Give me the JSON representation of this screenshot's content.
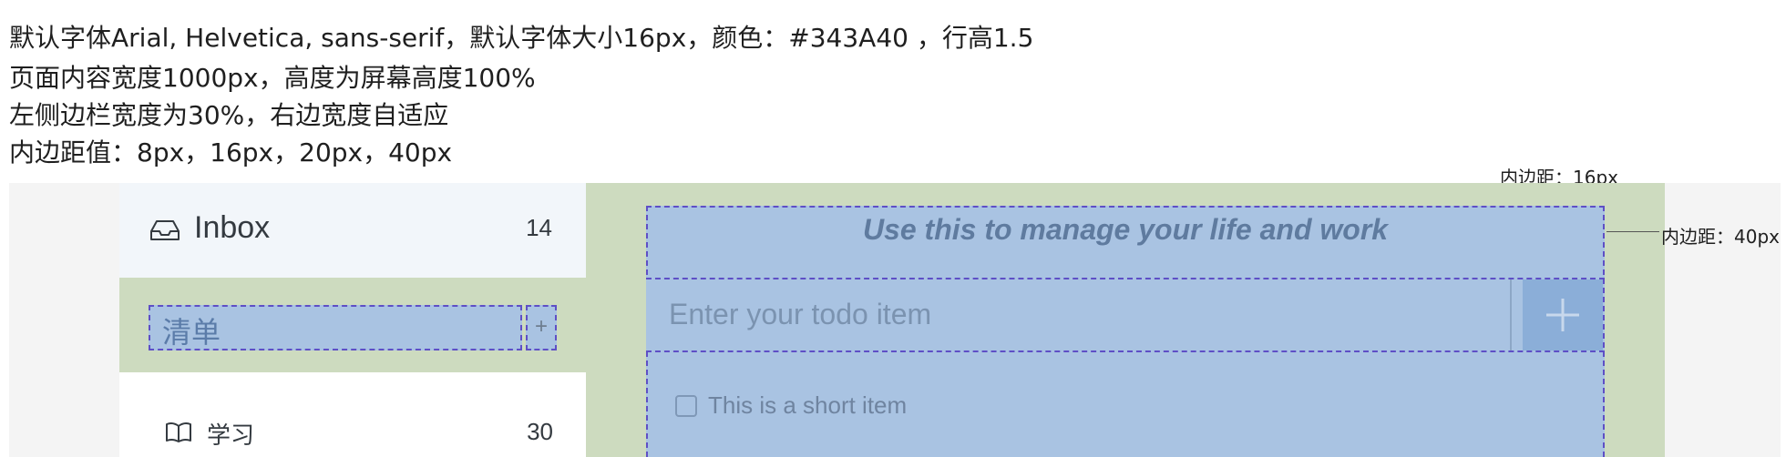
{
  "notes": {
    "line1": "默认字体Arial, Helvetica, sans-serif，默认字体大小16px，颜色：#343A40 ，行高1.5",
    "line2": "页面内容宽度1000px，高度为屏幕高度100%",
    "line3": "左侧边栏宽度为30%，右边宽度自适应",
    "line4": "内边距值：8px，16px，20px，40px"
  },
  "annotations": {
    "top_padding": "内边距：16px",
    "right_padding": "内边距：40px"
  },
  "sidebar": {
    "inbox": {
      "label": "Inbox",
      "count": "14",
      "icon": "inbox-icon"
    },
    "list_input": {
      "placeholder": "清单",
      "add_label": "+"
    },
    "items": [
      {
        "label": "学习",
        "count": "30",
        "icon": "book-icon"
      }
    ]
  },
  "main": {
    "tagline": "Use this to manage your life and work",
    "todo_placeholder": "Enter your todo item",
    "add_icon": "plus-icon",
    "items": [
      {
        "label": "This is a short item",
        "checked": false
      }
    ]
  },
  "colors": {
    "text": "#343A40",
    "sidebar_active": "#f2f6fa",
    "padding_area": "#cddbbf",
    "content_area": "#a9c3e2",
    "outline": "#5e4fc6",
    "add_button": "#8baed8"
  }
}
